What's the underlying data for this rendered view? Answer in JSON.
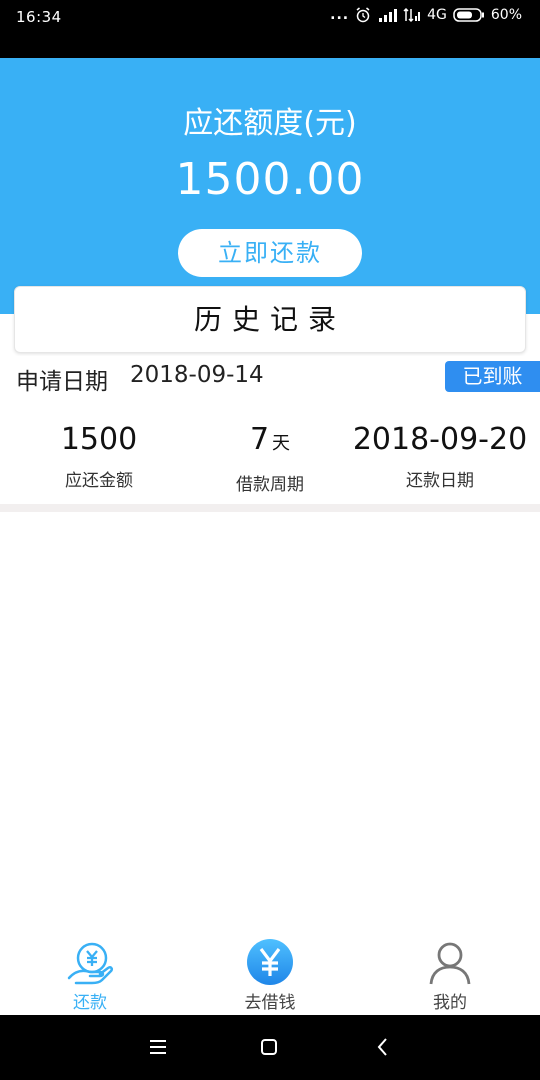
{
  "status_bar": {
    "time": "16:34",
    "dots": "...",
    "network": "4G",
    "battery": "60%"
  },
  "header": {
    "title": "应还额度(元)",
    "amount": "1500.00",
    "repay_button": "立即还款"
  },
  "history": {
    "tab_label": "历史记录"
  },
  "record": {
    "apply_label": "申请日期",
    "apply_date": "2018-09-14",
    "status": "已到账",
    "stats": [
      {
        "value": "1500",
        "unit": "",
        "label": "应还金额"
      },
      {
        "value": "7",
        "unit": "天",
        "label": "借款周期"
      },
      {
        "value": "2018-09-20",
        "unit": "",
        "label": "还款日期"
      }
    ]
  },
  "bottom_nav": {
    "items": [
      {
        "label": "还款",
        "icon": "repay-hand-yen-icon",
        "active": true
      },
      {
        "label": "去借钱",
        "icon": "yen-coin-icon",
        "active": false
      },
      {
        "label": "我的",
        "icon": "person-icon",
        "active": false
      }
    ]
  },
  "colors": {
    "primary": "#39b0f5",
    "badge": "#2f8ef0"
  }
}
